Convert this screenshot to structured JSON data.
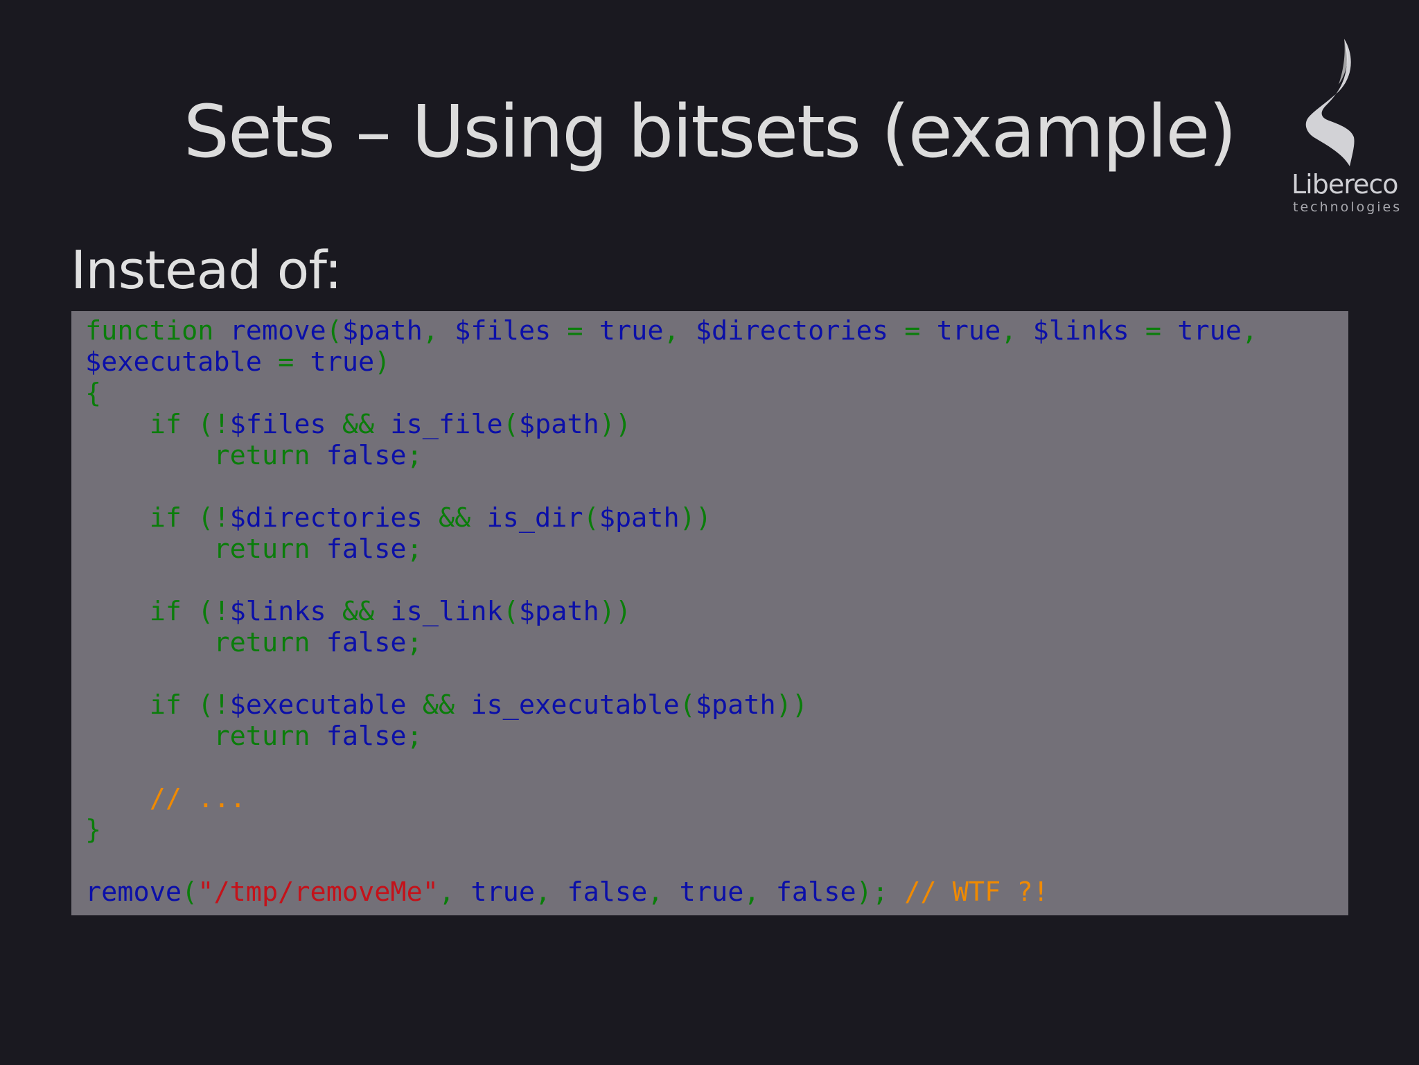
{
  "slide": {
    "title": "Sets – Using bitsets (example)",
    "subheading": "Instead of:"
  },
  "logo": {
    "name": "Libereco",
    "tagline": "technologies"
  },
  "colors": {
    "background": "#1a1920",
    "code_background": "#737078",
    "keyword": "#0a7d0a",
    "identifier": "#0b0fa8",
    "string": "#c4121a",
    "comment": "#f08a00"
  },
  "code": {
    "lines": [
      [
        [
          "kw",
          "function "
        ],
        [
          "id",
          "remove"
        ],
        [
          "kw",
          "("
        ],
        [
          "id",
          "$path"
        ],
        [
          "kw",
          ", "
        ],
        [
          "id",
          "$files"
        ],
        [
          "kw",
          " = "
        ],
        [
          "id",
          "true"
        ],
        [
          "kw",
          ", "
        ],
        [
          "id",
          "$directories"
        ],
        [
          "kw",
          " = "
        ],
        [
          "id",
          "true"
        ],
        [
          "kw",
          ", "
        ],
        [
          "id",
          "$links"
        ],
        [
          "kw",
          " = "
        ],
        [
          "id",
          "true"
        ],
        [
          "kw",
          ","
        ]
      ],
      [
        [
          "id",
          "$executable"
        ],
        [
          "kw",
          " = "
        ],
        [
          "id",
          "true"
        ],
        [
          "kw",
          ")"
        ]
      ],
      [
        [
          "kw",
          "{"
        ]
      ],
      [
        [
          "kw",
          "    if (!"
        ],
        [
          "id",
          "$files"
        ],
        [
          "kw",
          " && "
        ],
        [
          "id",
          "is_file"
        ],
        [
          "kw",
          "("
        ],
        [
          "id",
          "$path"
        ],
        [
          "kw",
          "))"
        ]
      ],
      [
        [
          "kw",
          "        return "
        ],
        [
          "id",
          "false"
        ],
        [
          "kw",
          ";"
        ]
      ],
      [],
      [
        [
          "kw",
          "    if (!"
        ],
        [
          "id",
          "$directories"
        ],
        [
          "kw",
          " && "
        ],
        [
          "id",
          "is_dir"
        ],
        [
          "kw",
          "("
        ],
        [
          "id",
          "$path"
        ],
        [
          "kw",
          "))"
        ]
      ],
      [
        [
          "kw",
          "        return "
        ],
        [
          "id",
          "false"
        ],
        [
          "kw",
          ";"
        ]
      ],
      [],
      [
        [
          "kw",
          "    if (!"
        ],
        [
          "id",
          "$links"
        ],
        [
          "kw",
          " && "
        ],
        [
          "id",
          "is_link"
        ],
        [
          "kw",
          "("
        ],
        [
          "id",
          "$path"
        ],
        [
          "kw",
          "))"
        ]
      ],
      [
        [
          "kw",
          "        return "
        ],
        [
          "id",
          "false"
        ],
        [
          "kw",
          ";"
        ]
      ],
      [],
      [
        [
          "kw",
          "    if (!"
        ],
        [
          "id",
          "$executable"
        ],
        [
          "kw",
          " && "
        ],
        [
          "id",
          "is_executable"
        ],
        [
          "kw",
          "("
        ],
        [
          "id",
          "$path"
        ],
        [
          "kw",
          "))"
        ]
      ],
      [
        [
          "kw",
          "        return "
        ],
        [
          "id",
          "false"
        ],
        [
          "kw",
          ";"
        ]
      ],
      [],
      [
        [
          "com",
          "    // ..."
        ]
      ],
      [
        [
          "kw",
          "}"
        ]
      ],
      [],
      [
        [
          "id",
          "remove"
        ],
        [
          "kw",
          "("
        ],
        [
          "str",
          "\"/tmp/removeMe\""
        ],
        [
          "kw",
          ", "
        ],
        [
          "id",
          "true"
        ],
        [
          "kw",
          ", "
        ],
        [
          "id",
          "false"
        ],
        [
          "kw",
          ", "
        ],
        [
          "id",
          "true"
        ],
        [
          "kw",
          ", "
        ],
        [
          "id",
          "false"
        ],
        [
          "kw",
          "); "
        ],
        [
          "com",
          "// WTF ?!"
        ]
      ]
    ]
  }
}
